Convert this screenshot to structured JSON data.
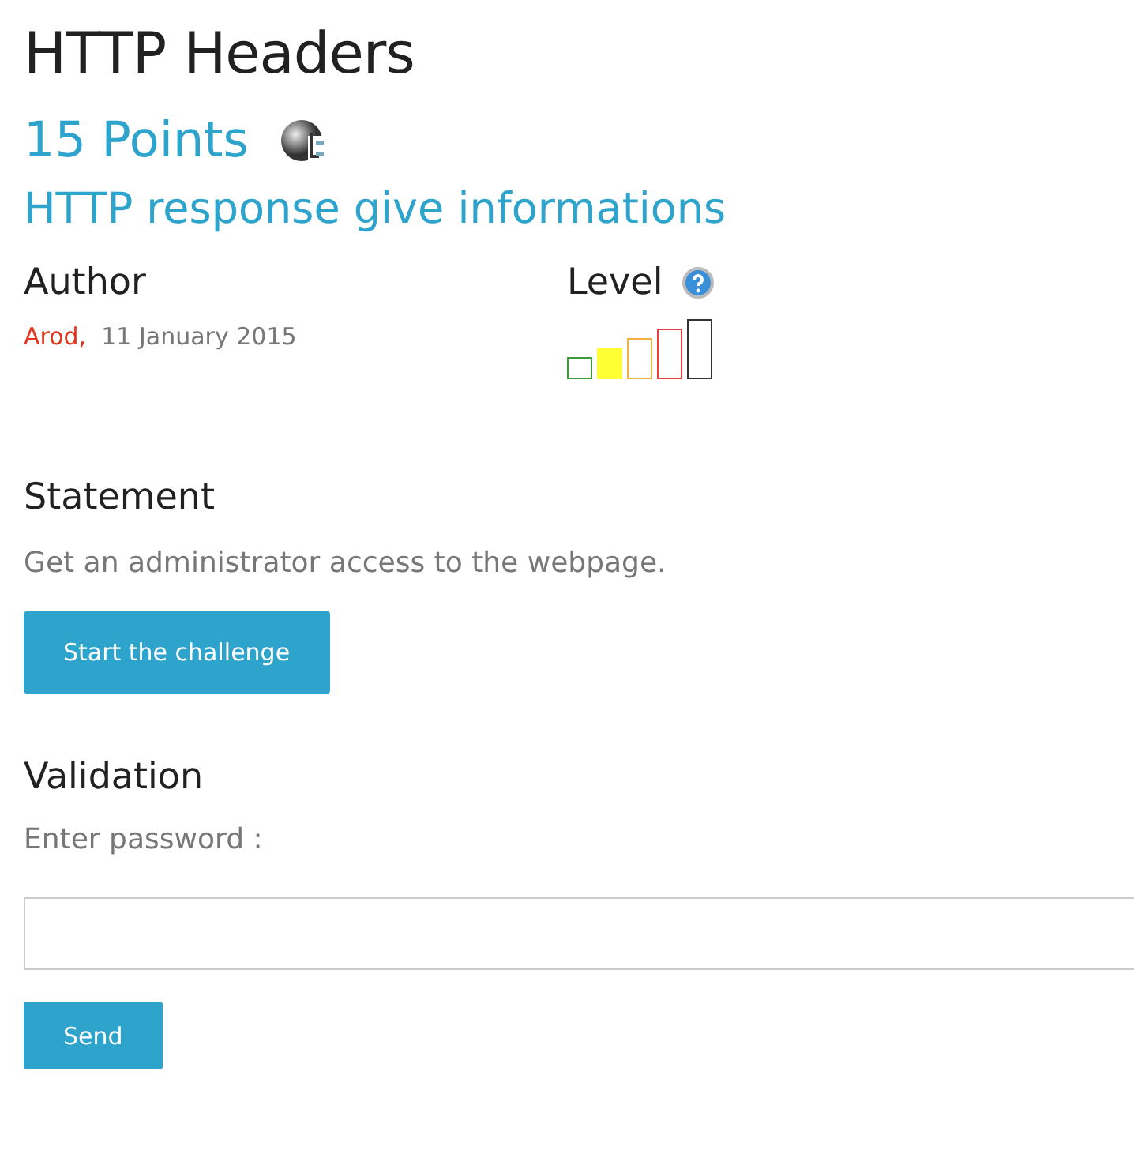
{
  "title": "HTTP Headers",
  "points": "15 Points",
  "subtitle": "HTTP response give informations",
  "author": {
    "heading": "Author",
    "name": "Arod",
    "separator": ",",
    "date": "11 January 2015"
  },
  "level": {
    "heading": "Level",
    "bars": [
      {
        "color": "#3c9a3c",
        "filled": false
      },
      {
        "color": "#ffff33",
        "filled": true
      },
      {
        "color": "#f5b041",
        "filled": false
      },
      {
        "color": "#f03c3c",
        "filled": false
      },
      {
        "color": "#333333",
        "filled": false
      }
    ]
  },
  "statement": {
    "heading": "Statement",
    "text": "Get an administrator access to the webpage.",
    "button": "Start the challenge"
  },
  "validation": {
    "heading": "Validation",
    "label": "Enter password :",
    "button": "Send"
  }
}
